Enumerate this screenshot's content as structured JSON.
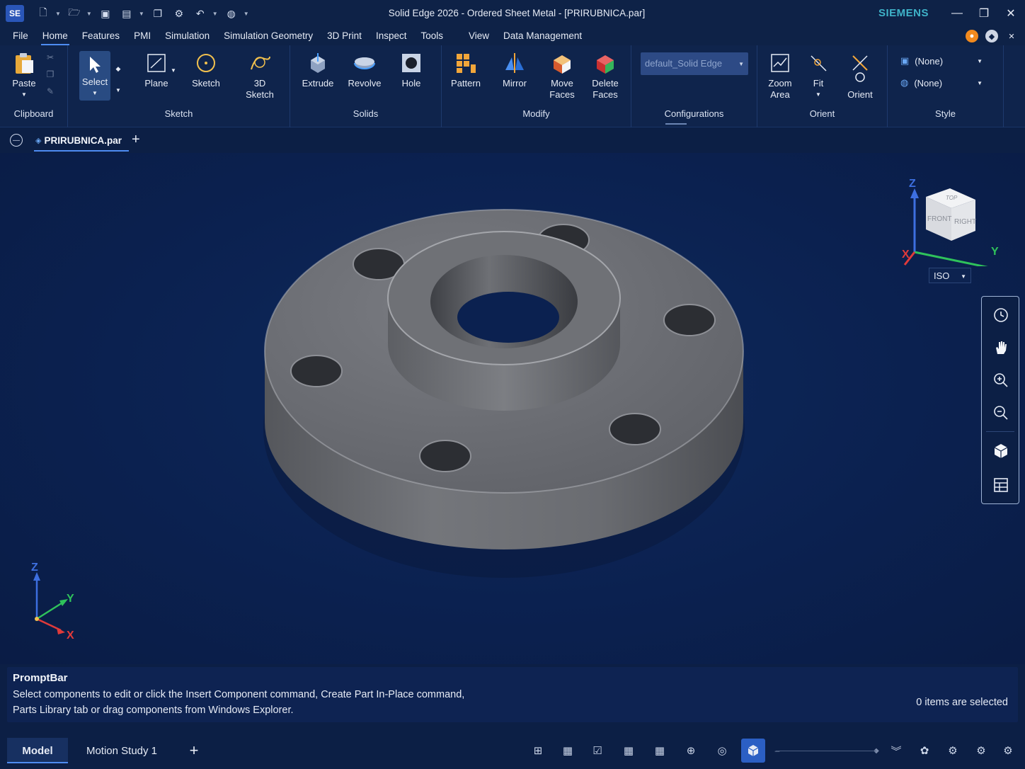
{
  "titlebar": {
    "app_badge": "SE",
    "title": "Solid Edge 2026 - Ordered Sheet Metal - [PRIRUBNICA.par]",
    "brand": "SIEMENS",
    "quick_access_icons": [
      "new-icon",
      "open-icon",
      "save-icon",
      "print-icon",
      "copy-icon",
      "settings-icon",
      "undo-icon",
      "globe-icon"
    ]
  },
  "menu": {
    "items": [
      "File",
      "Home",
      "Features",
      "PMI",
      "Simulation",
      "Simulation Geometry",
      "3D Print",
      "Inspect",
      "Tools",
      "View",
      "Data Management"
    ],
    "active": "Home"
  },
  "ribbon": {
    "groups": {
      "clipboard": "Clipboard",
      "sketch": "Sketch",
      "solids": "Solids",
      "modify": "Modify",
      "configurations": "Configurations",
      "orient": "Orient",
      "style": "Style"
    },
    "buttons": {
      "paste": "Paste",
      "select": "Select",
      "plane": "Plane",
      "sketch": "Sketch",
      "sketch3d_line1": "3D",
      "sketch3d_line2": "Sketch",
      "extrude": "Extrude",
      "revolve": "Revolve",
      "hole": "Hole",
      "pattern": "Pattern",
      "mirror": "Mirror",
      "move_faces_line1": "Move",
      "move_faces_line2": "Faces",
      "delete_faces_line1": "Delete",
      "delete_faces_line2": "Faces",
      "zoom_area_line1": "Zoom",
      "zoom_area_line2": "Area",
      "fit": "Fit",
      "orient": "Orient"
    },
    "configuration_value": "default_Solid Edge",
    "style_values": [
      "(None)",
      "(None)"
    ]
  },
  "document_tab": {
    "name": "PRIRUBNICA.par"
  },
  "viewport": {
    "view_cube_faces": {
      "top": "TOP",
      "front": "FRONT",
      "right": "RIGHT"
    },
    "axes": {
      "x": "X",
      "y": "Y",
      "z": "Z"
    },
    "view_select": "ISO",
    "nav_tools": [
      "history-icon",
      "pan-icon",
      "zoom-in-icon",
      "zoom-out-icon",
      "view-cube-icon",
      "table-icon"
    ],
    "colors": {
      "background": "#0c1f45",
      "axis_x": "#e03a3a",
      "axis_y": "#2fc25b",
      "axis_z": "#3d6fe0",
      "part": "#6b6d72"
    }
  },
  "promptbar": {
    "title": "PromptBar",
    "line1": "Select components to edit or click the Insert Component command, Create Part In-Place command,",
    "line2": "Parts Library tab or drag components from Windows Explorer.",
    "status": "0 items are selected"
  },
  "bottom": {
    "tabs": [
      "Model",
      "Motion Study 1"
    ],
    "active_tab": "Model",
    "add_tab": "+"
  }
}
